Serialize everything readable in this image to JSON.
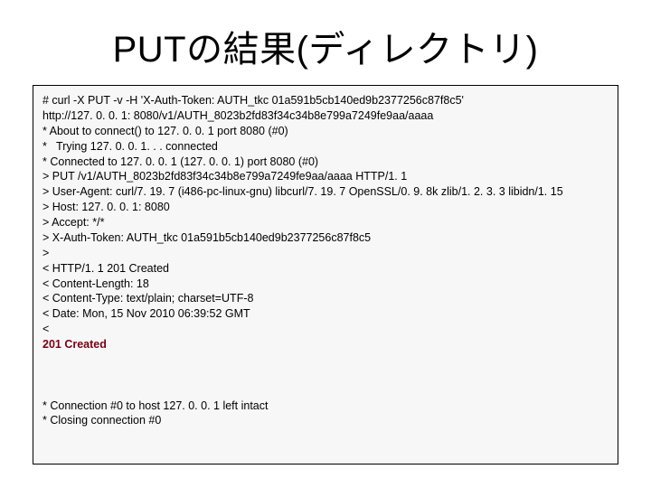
{
  "slide": {
    "title": "PUTの結果(ディレクトリ)",
    "terminal": {
      "lines": [
        "# curl -X PUT -v -H 'X-Auth-Token: AUTH_tkc 01a591b5cb140ed9b2377256c87f8c5'",
        "http://127. 0. 0. 1: 8080/v1/AUTH_8023b2fd83f34c34b8e799a7249fe9aa/aaaa",
        "* About to connect() to 127. 0. 0. 1 port 8080 (#0)",
        "*   Trying 127. 0. 0. 1. . . connected",
        "* Connected to 127. 0. 0. 1 (127. 0. 0. 1) port 8080 (#0)",
        "> PUT /v1/AUTH_8023b2fd83f34c34b8e799a7249fe9aa/aaaa HTTP/1. 1",
        "> User-Agent: curl/7. 19. 7 (i486-pc-linux-gnu) libcurl/7. 19. 7 OpenSSL/0. 9. 8k zlib/1. 2. 3. 3 libidn/1. 15",
        "> Host: 127. 0. 0. 1: 8080",
        "> Accept: */*",
        "> X-Auth-Token: AUTH_tkc 01a591b5cb140ed9b2377256c87f8c5",
        ">",
        "< HTTP/1. 1 201 Created",
        "< Content-Length: 18",
        "< Content-Type: text/plain; charset=UTF-8",
        "< Date: Mon, 15 Nov 2010 06:39:52 GMT",
        "<"
      ],
      "highlight_line": "201 Created",
      "tail_lines": [
        "* Connection #0 to host 127. 0. 0. 1 left intact",
        "* Closing connection #0"
      ]
    }
  }
}
